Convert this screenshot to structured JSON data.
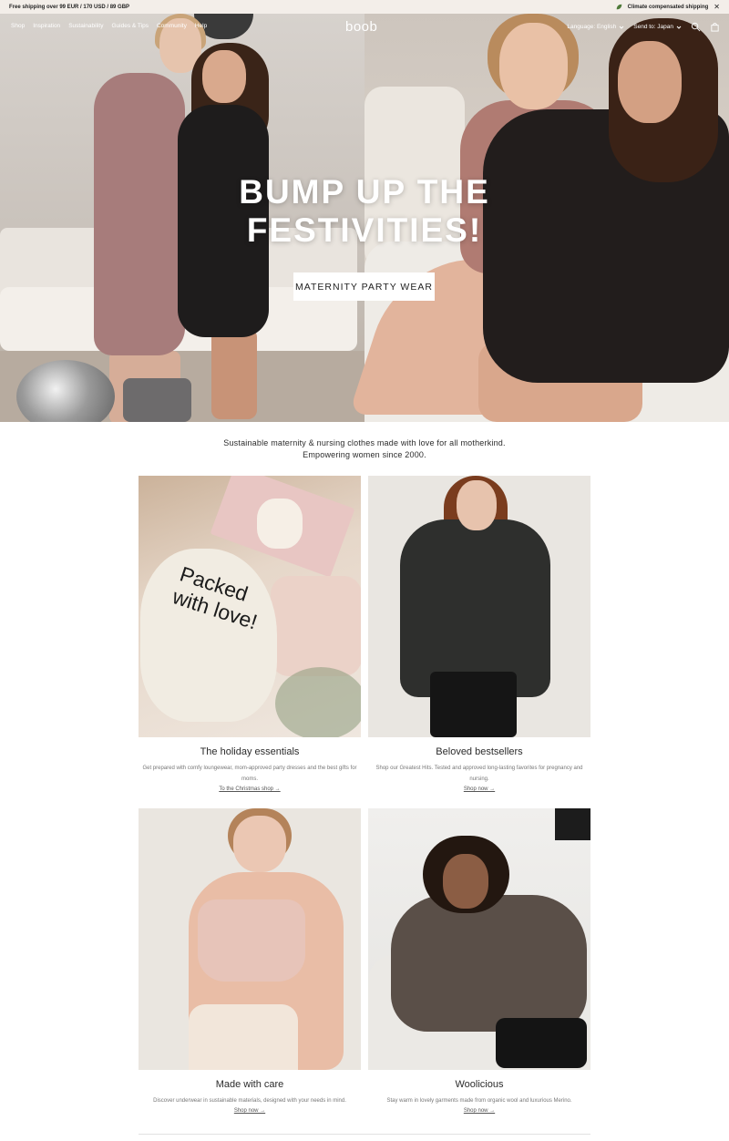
{
  "announcement": {
    "shipping_text": "Free shipping over 99 EUR / 170 USD / 89 GBP",
    "climate_text": "Climate compensated shipping",
    "close_icon": "close-icon",
    "leaf_icon": "leaf-icon"
  },
  "nav": {
    "links": [
      "Shop",
      "Inspiration",
      "Sustainability",
      "Guides & Tips",
      "Community",
      "Help"
    ],
    "logo": "boob",
    "language_label": "Language: English",
    "send_to_label": "Send to: Japan",
    "search_icon": "search-icon",
    "bag_icon": "shopping-bag-icon"
  },
  "hero": {
    "title_line1": "BUMP UP THE",
    "title_line2": "FESTIVITIES!",
    "button_label": "MATERNITY PARTY WEAR"
  },
  "intro": {
    "line1": "Sustainable maternity & nursing clothes made with love for all motherkind.",
    "line2": "Empowering women since 2000."
  },
  "cards": [
    {
      "title": "The holiday essentials",
      "description": "Get prepared with comfy loungewear, mom-approved party dresses and the best gifts for moms.",
      "link": "To the Christmas shop →",
      "image_text_line1": "Packed",
      "image_text_line2": "with love!"
    },
    {
      "title": "Beloved bestsellers",
      "description": "Shop our Greatest Hits. Tested and approved long-lasting favorites for pregnancy and nursing.",
      "link": "Shop now →"
    },
    {
      "title": "Made with care",
      "description": "Discover underwear in sustainable materials, designed with your needs in mind.",
      "link": "Shop now →"
    },
    {
      "title": "Woolicious",
      "description": "Stay warm in lovely garments made from organic wool and luxurious Merino.",
      "link": "Shop now →"
    }
  ],
  "colors": {
    "topbar_bg": "#f3eee9",
    "text": "#2b2b2b",
    "hero_button_bg": "#ffffff"
  }
}
